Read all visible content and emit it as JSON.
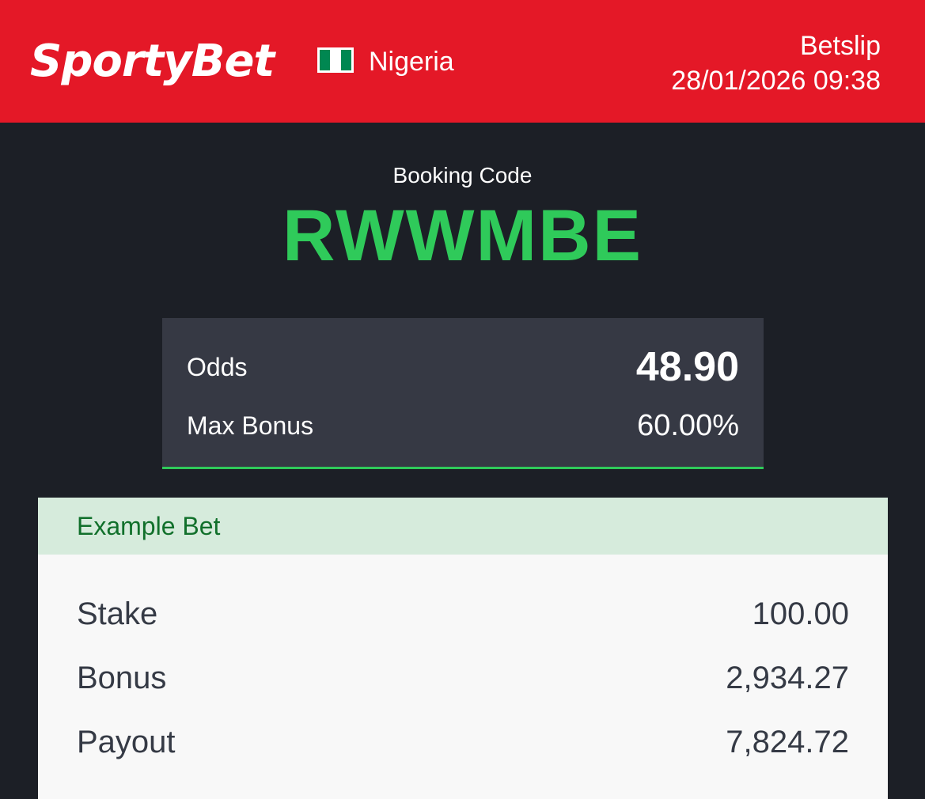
{
  "header": {
    "logo_text": "SportyBet",
    "country": "Nigeria",
    "flag_icon": "nigeria-flag-icon",
    "page_title": "Betslip",
    "datetime": "28/01/2026 09:38",
    "background_color": "#e41827"
  },
  "booking": {
    "label": "Booking Code",
    "code": "RWWMBE",
    "code_color": "#2fca5a"
  },
  "summary": {
    "odds_label": "Odds",
    "odds_value": "48.90",
    "max_bonus_label": "Max Bonus",
    "max_bonus_value": "60.00%"
  },
  "example_bet": {
    "title": "Example Bet",
    "rows": [
      {
        "label": "Stake",
        "value": "100.00"
      },
      {
        "label": "Bonus",
        "value": "2,934.27"
      },
      {
        "label": "Payout",
        "value": "7,824.72"
      }
    ]
  }
}
